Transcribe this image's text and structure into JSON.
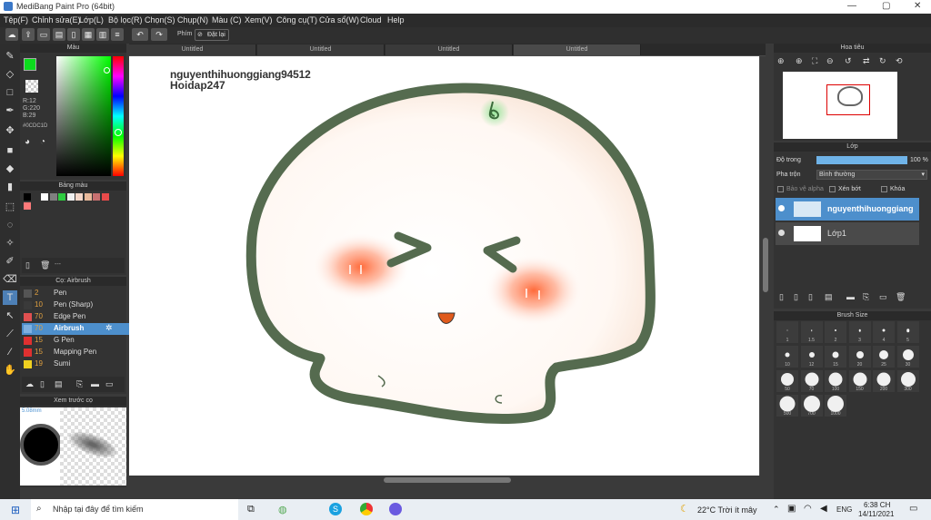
{
  "window": {
    "title": "MediBang Paint Pro (64bit)",
    "min": "—",
    "max": "▢",
    "close": "✕"
  },
  "menu": [
    "Tệp(F)",
    "Chỉnh sửa(E)",
    "Lớp(L)",
    "Bộ lọc(R)",
    "Chọn(S)",
    "Chụp(N)",
    "Màu (C)",
    "Xem(V)",
    "Công cụ(T)",
    "Cửa sổ(W)",
    "Cloud",
    "Help"
  ],
  "toolbar": {
    "phim_label": "Phím",
    "reset_label": "Đặt lại"
  },
  "tabs": [
    "Untitled",
    "Untitled",
    "Untitled",
    "Untitled"
  ],
  "color_panel": {
    "title": "Màu",
    "r": "R:12",
    "g": "G:220",
    "b": "B:29",
    "hex": "#0CDC1D",
    "fg_color": "#0cdc1d"
  },
  "palette_panel": {
    "title": "Bảng màu",
    "swatches": [
      "#000000",
      "#333333",
      "#ffffff",
      "#808080",
      "#2ecc40",
      "#f0f0f0",
      "#f4d6c8",
      "#e8b89a",
      "#c87070",
      "#e84a4a",
      "#ff7a7a"
    ],
    "rename": "---"
  },
  "brush_panel": {
    "title": "Cọ: Airbrush",
    "items": [
      {
        "size": "2",
        "name": "Pen",
        "color": "#555555"
      },
      {
        "size": "10",
        "name": "Pen (Sharp)",
        "color": "#3a3a3a"
      },
      {
        "size": "70",
        "name": "Edge Pen",
        "color": "#e05050"
      },
      {
        "size": "70",
        "name": "Airbrush",
        "color": "#7fb0e0"
      },
      {
        "size": "15",
        "name": "G Pen",
        "color": "#e03030"
      },
      {
        "size": "15",
        "name": "Mapping Pen",
        "color": "#e03030"
      },
      {
        "size": "19",
        "name": "Sumi",
        "color": "#f0d020"
      }
    ]
  },
  "preview_panel": {
    "title": "Xem trước cọ",
    "size": "5.08mm"
  },
  "canvas": {
    "text1": "nguyenthihuonggiang94512",
    "text2": "Hoidap247"
  },
  "navigator": {
    "title": "Hoa tiêu"
  },
  "layer_panel": {
    "title": "Lớp",
    "opacity_label": "Độ trong",
    "opacity_value": "100 %",
    "opacity_pct": 100,
    "blend_label": "Pha trộn",
    "blend_value": "Bình thường",
    "protect_alpha": "Bảo vệ alpha",
    "clip": "Xén bớt",
    "lock": "Khóa",
    "layers": [
      {
        "name": "nguyenthihuonggiang",
        "active": true
      },
      {
        "name": "Lớp1",
        "active": false
      }
    ]
  },
  "brush_size_panel": {
    "title": "Brush Size",
    "sizes": [
      "1",
      "1.5",
      "2",
      "3",
      "4",
      "5",
      "10",
      "12",
      "15",
      "20",
      "25",
      "30",
      "50",
      "70",
      "100",
      "150",
      "200",
      "300",
      "500",
      "700",
      "1000"
    ]
  },
  "taskbar": {
    "search": "Nhập tại đây để tìm kiếm",
    "weather": "22°C  Trời ít mây",
    "lang": "ENG",
    "time": "6:38 CH",
    "date": "14/11/2021"
  }
}
